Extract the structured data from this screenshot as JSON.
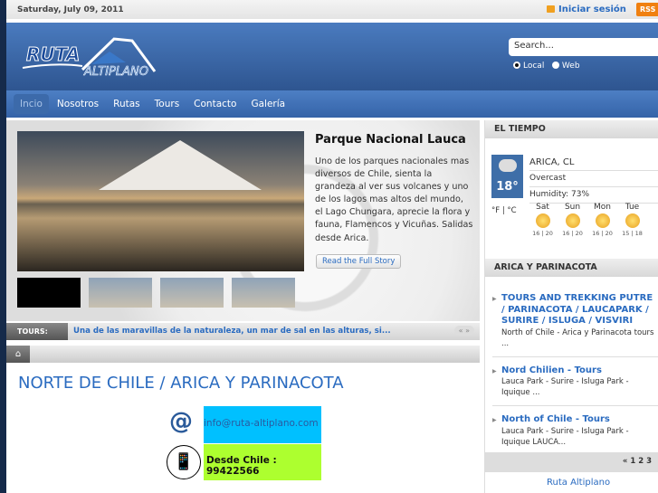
{
  "topbar": {
    "date": "Saturday, July 09, 2011",
    "login": "Iniciar sesión",
    "rss": "RSS"
  },
  "header": {
    "logo_text": "RUTA ALTIPLANO",
    "search_placeholder": "Search...",
    "radio_local": "Local",
    "radio_web": "Web"
  },
  "nav": [
    "Incio",
    "Nosotros",
    "Rutas",
    "Tours",
    "Contacto",
    "Galería"
  ],
  "feature": {
    "title": "Parque Nacional Lauca",
    "text": "Uno de los parques nacionales mas diversos de Chile, sienta la grandeza al ver sus volcanes y uno de los lagos mas altos del mundo, el Lago Chungara, aprecie la flora y fauna, Flamencos y Vicuñas. Salidas desde Arica.",
    "read_more": "Read the Full Story"
  },
  "ticker": {
    "label": "TOURS:",
    "text": "Una de las maravillas de la naturaleza, un mar de sal en las alturas, si...",
    "arrows": "« »"
  },
  "page_title": "NORTE DE CHILE / ARICA Y PARINACOTA",
  "contact": {
    "email": "info@ruta-altiplano.com",
    "phone": "Desde Chile :  99422566"
  },
  "weather": {
    "heading": "EL TIEMPO",
    "location": "ARICA, CL",
    "condition": "Overcast",
    "humidity": "Humidity: 73%",
    "temp": "18°",
    "units": "°F | °C",
    "days": [
      {
        "d": "Sat",
        "t": "16 | 20"
      },
      {
        "d": "Sun",
        "t": "16 | 20"
      },
      {
        "d": "Mon",
        "t": "16 | 20"
      },
      {
        "d": "Tue",
        "t": "15 | 18"
      }
    ]
  },
  "region": {
    "heading": "ARICA Y PARINACOTA",
    "items": [
      {
        "title": "TOURS AND TREKKING PUTRE / PARINACOTA / LAUCAPARK / SURIRE / ISLUGA / VISVIRI",
        "desc": "North of Chile - Arica y Parinacota tours ..."
      },
      {
        "title": "Nord Chilien - Tours",
        "desc": "Lauca Park - Surire - Isluga Park - Iquique ..."
      },
      {
        "title": "North of Chile - Tours",
        "desc": "Lauca Park - Surire - Isluga Park - Iquique LAUCA..."
      }
    ],
    "pager": "« 1 2 3"
  },
  "footer": "Ruta Altiplano"
}
